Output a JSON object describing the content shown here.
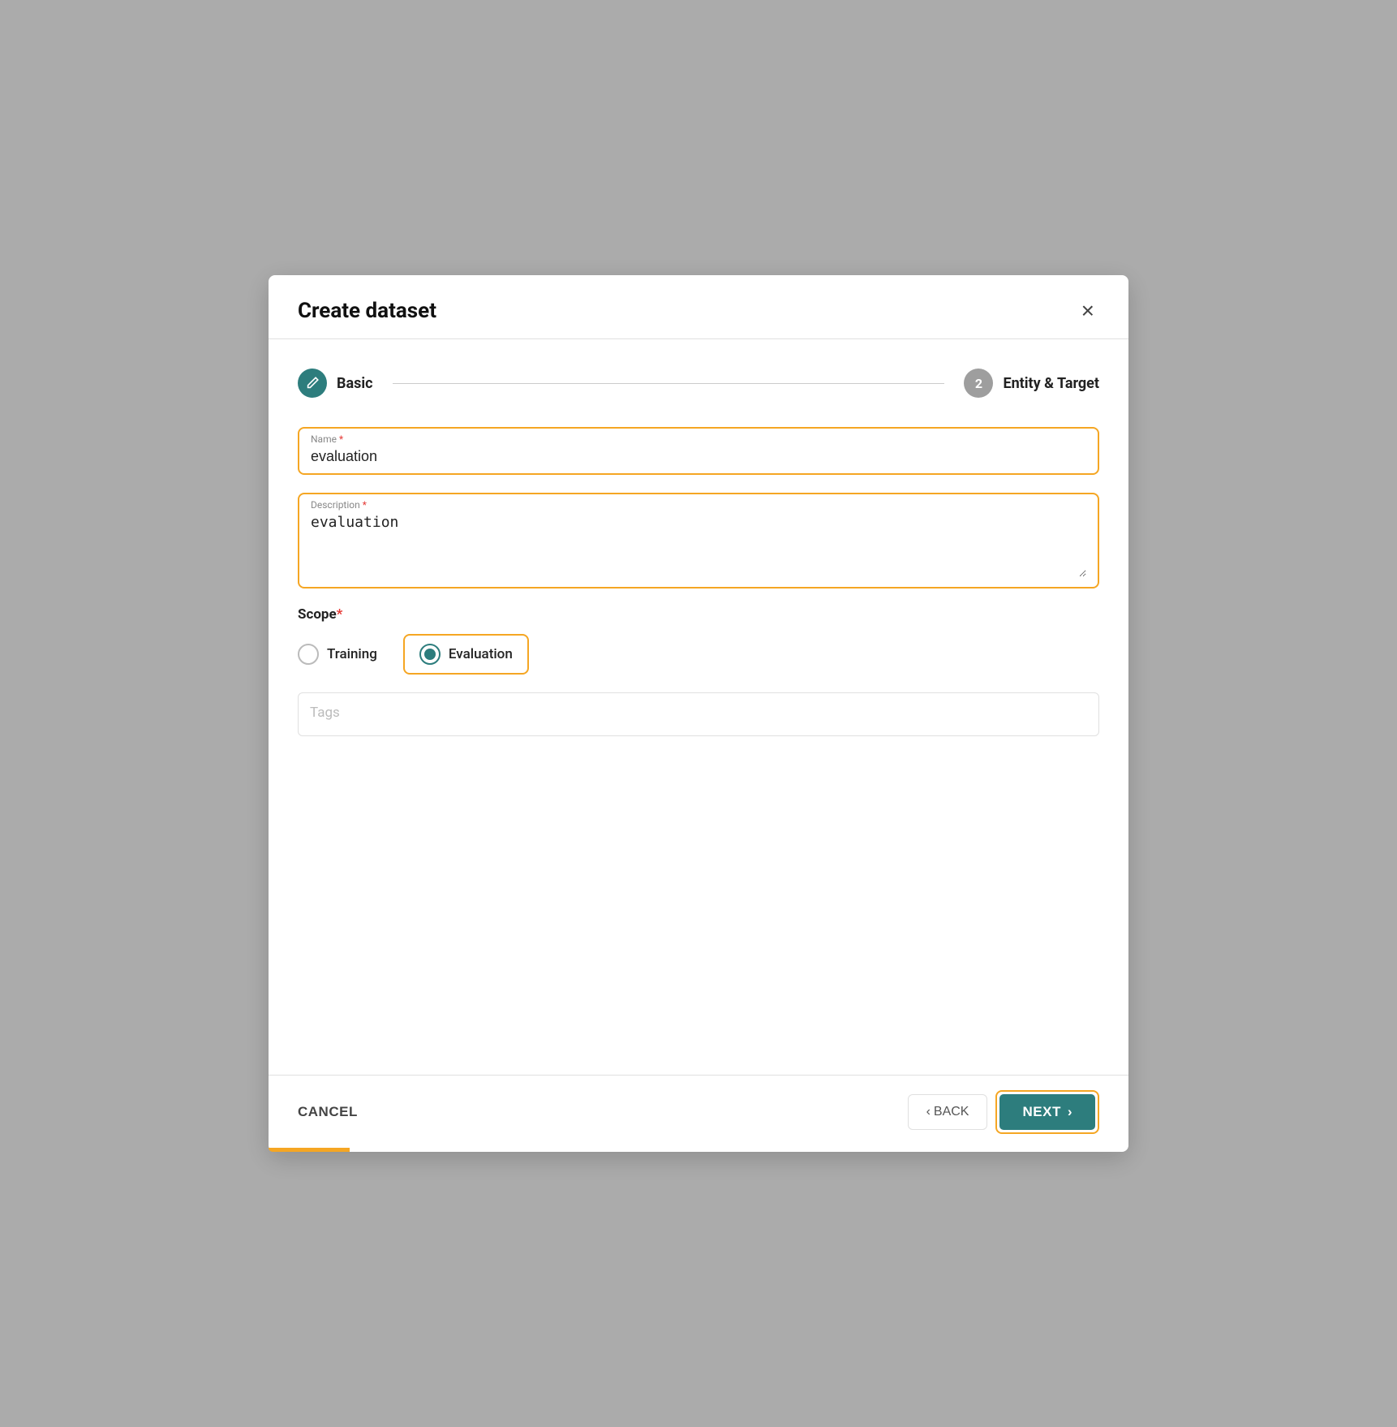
{
  "modal": {
    "title": "Create dataset",
    "close_label": "×"
  },
  "steps": [
    {
      "id": "basic",
      "number": "✎",
      "label": "Basic",
      "state": "active"
    },
    {
      "id": "entity-target",
      "number": "2",
      "label": "Entity & Target",
      "state": "inactive"
    }
  ],
  "form": {
    "name_label": "Name",
    "name_required": "*",
    "name_value": "evaluation",
    "description_label": "Description",
    "description_required": "*",
    "description_value": "evaluation",
    "scope_label": "Scope",
    "scope_required": "*",
    "scope_options": [
      {
        "id": "training",
        "label": "Training",
        "selected": false
      },
      {
        "id": "evaluation",
        "label": "Evaluation",
        "selected": true
      }
    ],
    "tags_placeholder": "Tags"
  },
  "footer": {
    "cancel_label": "CANCEL",
    "back_label": "BACK",
    "next_label": "NEXT",
    "back_chevron": "‹",
    "next_chevron": "›"
  }
}
